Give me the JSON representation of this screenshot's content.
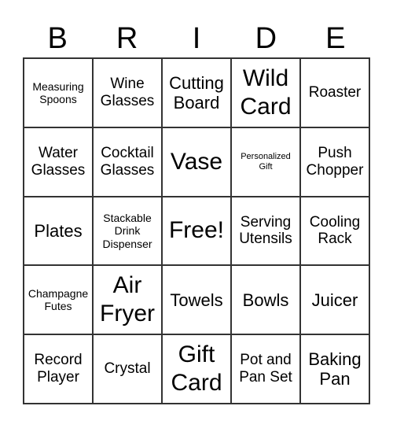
{
  "header": [
    "B",
    "R",
    "I",
    "D",
    "E"
  ],
  "cells": [
    {
      "text": "Measuring Spoons",
      "size": "sm"
    },
    {
      "text": "Wine Glasses",
      "size": "md"
    },
    {
      "text": "Cutting Board",
      "size": "lg"
    },
    {
      "text": "Wild Card",
      "size": "xl"
    },
    {
      "text": "Roaster",
      "size": "md"
    },
    {
      "text": "Water Glasses",
      "size": "md"
    },
    {
      "text": "Cocktail Glasses",
      "size": "md"
    },
    {
      "text": "Vase",
      "size": "xl"
    },
    {
      "text": "Personalized Gift",
      "size": "xs"
    },
    {
      "text": "Push Chopper",
      "size": "md"
    },
    {
      "text": "Plates",
      "size": "lg"
    },
    {
      "text": "Stackable Drink Dispenser",
      "size": "sm"
    },
    {
      "text": "Free!",
      "size": "xl"
    },
    {
      "text": "Serving Utensils",
      "size": "md"
    },
    {
      "text": "Cooling Rack",
      "size": "md"
    },
    {
      "text": "Champagne Futes",
      "size": "sm"
    },
    {
      "text": "Air Fryer",
      "size": "xl"
    },
    {
      "text": "Towels",
      "size": "lg"
    },
    {
      "text": "Bowls",
      "size": "lg"
    },
    {
      "text": "Juicer",
      "size": "lg"
    },
    {
      "text": "Record Player",
      "size": "md"
    },
    {
      "text": "Crystal",
      "size": "md"
    },
    {
      "text": "Gift Card",
      "size": "xl"
    },
    {
      "text": "Pot and Pan Set",
      "size": "md"
    },
    {
      "text": "Baking Pan",
      "size": "lg"
    }
  ]
}
